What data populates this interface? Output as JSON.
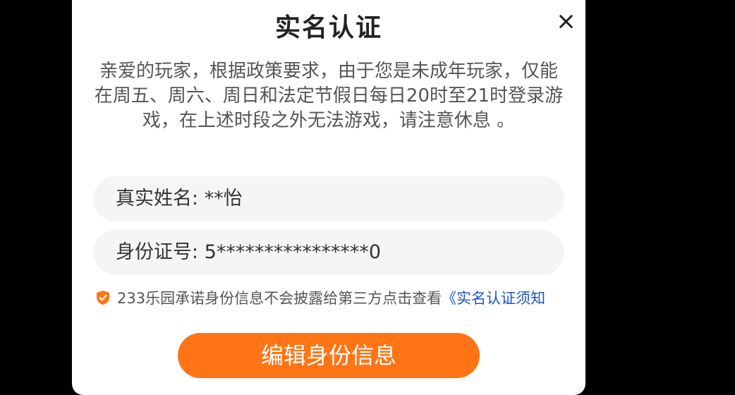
{
  "dialog": {
    "title": "实名认证",
    "close_icon": "close-icon",
    "message": "亲爱的玩家，根据政策要求，由于您是未成年玩家，仅能在周五、周六、周日和法定节假日每日20时至21时登录游戏，在上述时段之外无法游戏，请注意休息 。",
    "name_label": "真实姓名:",
    "name_value": "**怡",
    "id_label": "身份证号:",
    "id_value": "5****************0",
    "privacy_text": "233乐园承诺身份信息不会披露给第三方点击查看",
    "privacy_link": "《实名认证须知",
    "shield_icon": "shield-check-icon",
    "edit_button_label": "编辑身份信息"
  },
  "colors": {
    "accent": "#ff7414",
    "link": "#1a56c8",
    "shield": "#ff7414",
    "field_bg": "#f5f5f5"
  }
}
